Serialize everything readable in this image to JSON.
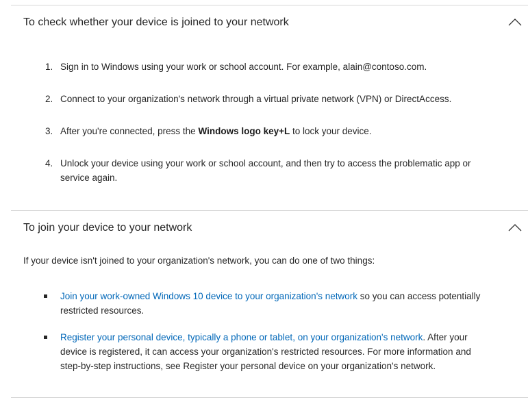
{
  "section1": {
    "title": "To check whether your device is joined to your network",
    "chevron_icon": "chevron-up-icon",
    "steps": [
      {
        "num": "1.",
        "text": "Sign in to Windows using your work or school account. For example, alain@contoso.com."
      },
      {
        "num": "2.",
        "text": "Connect to your organization's network through a virtual private network (VPN) or DirectAccess."
      },
      {
        "num": "3.",
        "text_before": "After you're connected, press the ",
        "bold": "Windows logo key+L",
        "text_after": " to lock your device."
      },
      {
        "num": "4.",
        "text": "Unlock your device using your work or school account, and then try to access the problematic app or service again."
      }
    ]
  },
  "section2": {
    "title": "To join your device to your network",
    "chevron_icon": "chevron-up-icon",
    "intro": "If your device isn't joined to your organization's network, you can do one of two things:",
    "bullets": [
      {
        "link": "Join your work-owned Windows 10 device to your organization's network",
        "text": " so you can access potentially restricted resources."
      },
      {
        "link": "Register your personal device, typically a phone or tablet, on your organization's network",
        "text": ". After your device is registered, it can access your organization's restricted resources. For more information and step-by-step instructions, see Register your personal device on your organization's network."
      }
    ]
  },
  "colors": {
    "link": "#0067b8",
    "text": "#262626",
    "divider": "#d6d6d6"
  }
}
